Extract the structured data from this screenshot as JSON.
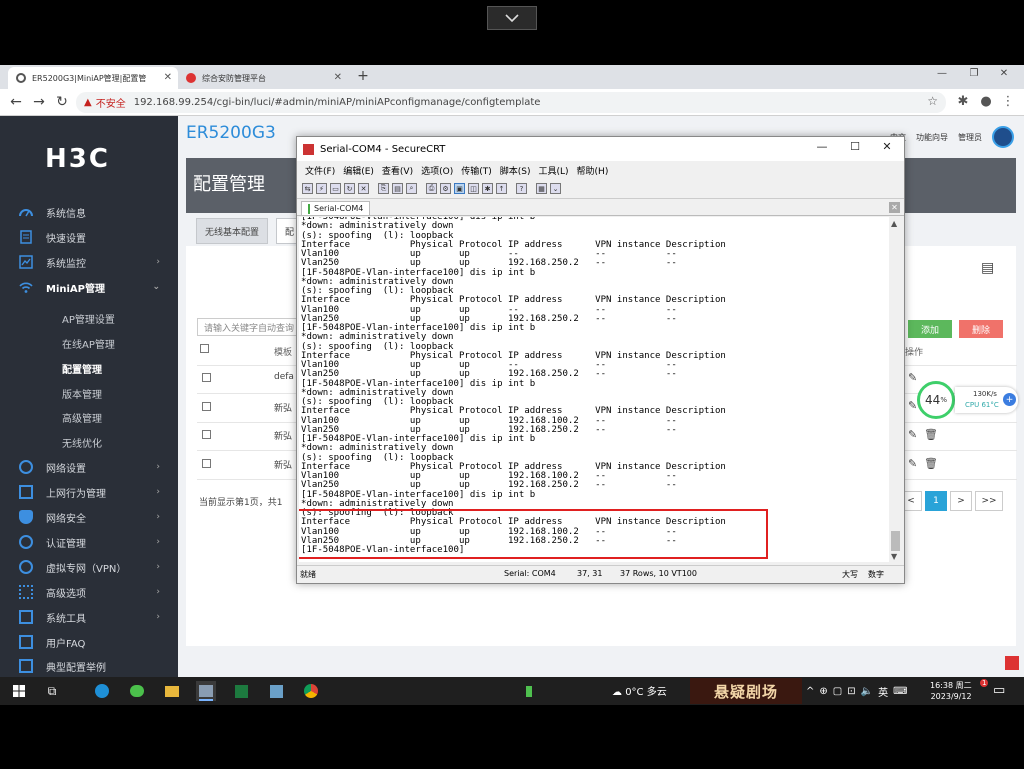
{
  "browser": {
    "tabs": [
      {
        "title": "ER5200G3|MiniAP管理|配置管"
      },
      {
        "title": "综合安防管理平台"
      }
    ],
    "address": {
      "insecure_label": "不安全",
      "url": "192.168.99.254/cgi-bin/luci/#admin/miniAP/miniAPconfigmanage/configtemplate"
    }
  },
  "sidebar": {
    "logo": "H3C",
    "items": [
      {
        "label": "系统信息",
        "icon": "dashboard-icon"
      },
      {
        "label": "快速设置",
        "icon": "clipboard-icon"
      },
      {
        "label": "系统监控",
        "icon": "chart-icon",
        "arrow": "›"
      },
      {
        "label": "MiniAP管理",
        "icon": "wifi-icon",
        "arrow": "⌄"
      }
    ],
    "subitems": [
      "AP管理设置",
      "在线AP管理",
      "配置管理",
      "版本管理",
      "高级管理",
      "无线优化"
    ],
    "items2": [
      {
        "label": "网络设置",
        "arrow": "›"
      },
      {
        "label": "上网行为管理",
        "arrow": "›"
      },
      {
        "label": "网络安全",
        "arrow": "›"
      },
      {
        "label": "认证管理",
        "arrow": "›"
      },
      {
        "label": "虚拟专网（VPN）",
        "arrow": "›"
      },
      {
        "label": "高级选项",
        "arrow": "›"
      },
      {
        "label": "系统工具",
        "arrow": "›"
      },
      {
        "label": "用户FAQ",
        "arrow": ""
      },
      {
        "label": "典型配置举例",
        "arrow": ""
      }
    ]
  },
  "content": {
    "brand": "ER5200G3",
    "topright": {
      "lang": "中文",
      "wizard": "功能向导",
      "admin": "管理员"
    },
    "page_title": "配置管理",
    "tabs": [
      "无线基本配置",
      "配"
    ],
    "search_placeholder": "请输入关键字自动查询",
    "add_label": "添加",
    "delete_label": "删除",
    "column_template": "模板",
    "column_ops": "操作",
    "rows": [
      "defa",
      "新弘",
      "新弘",
      "新弘"
    ],
    "pager_text": "当前显示第1页，共1",
    "pager": {
      "prev": "<",
      "current": "1",
      "next": ">",
      "last": ">>"
    }
  },
  "cpu_widget": {
    "percent": "44",
    "percent_unit": "%",
    "net": "130K/s",
    "cpu": "CPU 61°C"
  },
  "securecrt": {
    "title": "Serial-COM4 - SecureCRT",
    "menu": [
      "文件(F)",
      "编辑(E)",
      "查看(V)",
      "选项(O)",
      "传输(T)",
      "脚本(S)",
      "工具(L)",
      "帮助(H)"
    ],
    "tab": "Serial-COM4",
    "terminal_lines": [
      "[1F-5048POE-Vlan-interface100] dis ip int b",
      "*down: administratively down",
      "(s): spoofing  (l): loopback",
      "Interface           Physical Protocol IP address      VPN instance Description",
      "Vlan100             up       up       --              --           --",
      "Vlan250             up       up       192.168.250.2   --           --",
      "[1F-5048POE-Vlan-interface100] dis ip int b",
      "*down: administratively down",
      "(s): spoofing  (l): loopback",
      "Interface           Physical Protocol IP address      VPN instance Description",
      "Vlan100             up       up       --              --           --",
      "Vlan250             up       up       192.168.250.2   --           --",
      "[1F-5048POE-Vlan-interface100] dis ip int b",
      "*down: administratively down",
      "(s): spoofing  (l): loopback",
      "Interface           Physical Protocol IP address      VPN instance Description",
      "Vlan100             up       up       --              --           --",
      "Vlan250             up       up       192.168.250.2   --           --",
      "[1F-5048POE-Vlan-interface100] dis ip int b",
      "*down: administratively down",
      "(s): spoofing  (l): loopback",
      "Interface           Physical Protocol IP address      VPN instance Description",
      "Vlan100             up       up       192.168.100.2   --           --",
      "Vlan250             up       up       192.168.250.2   --           --",
      "[1F-5048POE-Vlan-interface100] dis ip int b",
      "*down: administratively down",
      "(s): spoofing  (l): loopback",
      "Interface           Physical Protocol IP address      VPN instance Description",
      "Vlan100             up       up       192.168.100.2   --           --",
      "Vlan250             up       up       192.168.250.2   --           --",
      "[1F-5048POE-Vlan-interface100] dis ip int b",
      "*down: administratively down",
      "(s): spoofing  (l): loopback",
      "Interface           Physical Protocol IP address      VPN instance Description",
      "Vlan100             up       up       192.168.100.2   --           --",
      "Vlan250             up       up       192.168.250.2   --           --",
      "[1F-5048POE-Vlan-interface100]"
    ],
    "status": {
      "ready": "就绪",
      "session": "Serial: COM4",
      "cursor": "37,  31",
      "size": "37 Rows, 10  VT100",
      "caps": "大写",
      "num": "数字"
    }
  },
  "taskbar": {
    "weather": "0°C  多云",
    "news": "悬疑剧场",
    "ime": "英",
    "time": "16:38 周二",
    "date": "2023/9/12",
    "notif_count": "1"
  }
}
